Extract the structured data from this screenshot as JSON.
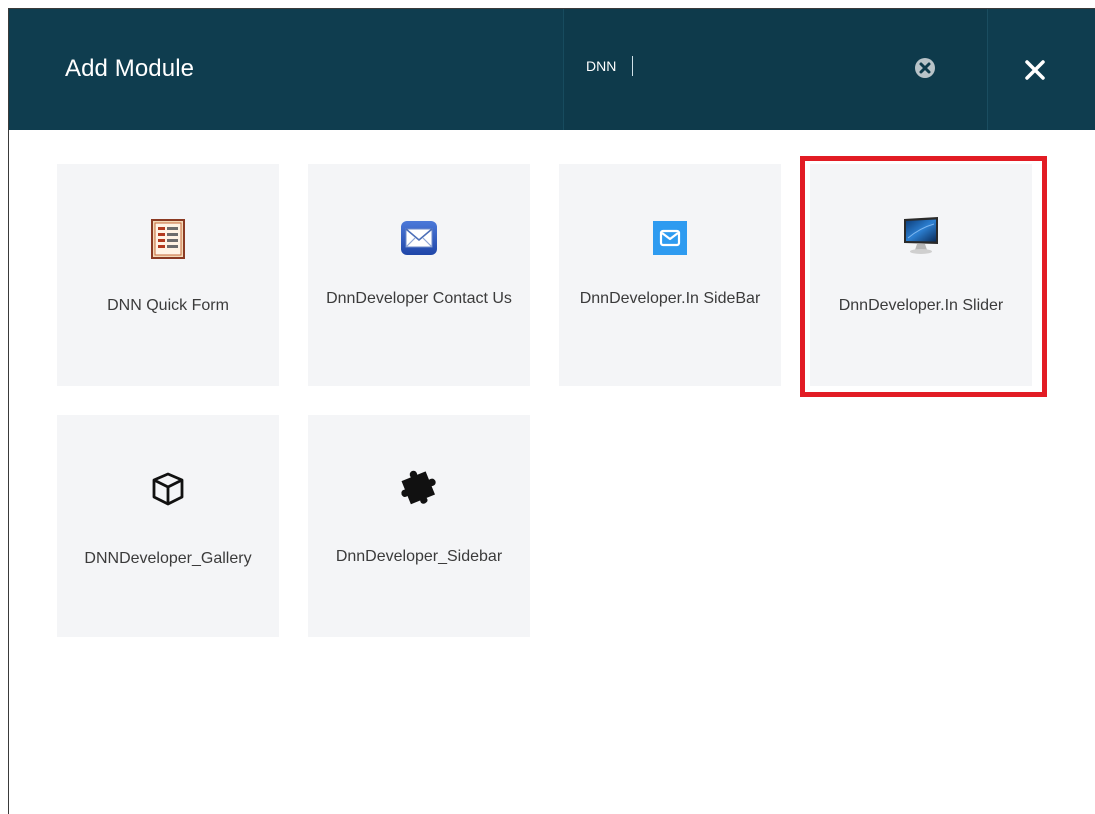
{
  "dialog": {
    "title": "Add Module",
    "search": {
      "value": "DNN",
      "placeholder": ""
    },
    "clear_icon": "circle-x-icon",
    "close_icon": "close-x-icon"
  },
  "modules": [
    {
      "label": "DNN Quick Form",
      "icon": "form-document-icon"
    },
    {
      "label": "DnnDeveloper Contact Us",
      "icon": "envelope-icon"
    },
    {
      "label": "DnnDeveloper.In SideBar",
      "icon": "mail-badge-icon"
    },
    {
      "label": "DnnDeveloper.In Slider",
      "icon": "monitor-icon",
      "highlighted": true
    },
    {
      "label": "DNNDeveloper_Gallery",
      "icon": "cube-icon"
    },
    {
      "label": "DnnDeveloper_Sidebar",
      "icon": "puzzle-piece-icon"
    }
  ],
  "colors": {
    "header_bg": "#0f3d4f",
    "tile_bg": "#f4f5f7",
    "highlight": "#e21c24"
  }
}
